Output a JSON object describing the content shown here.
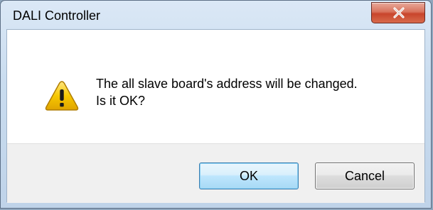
{
  "window": {
    "title": "DALI Controller"
  },
  "message": {
    "line1": "The all slave board's address will be changed.",
    "line2": "Is it OK?",
    "icon": "warning-icon"
  },
  "buttons": {
    "ok_label": "OK",
    "cancel_label": "Cancel"
  },
  "colors": {
    "titlebar": "#c9dcef",
    "close_button": "#c8452c",
    "default_button_border": "#3c7fb1",
    "warning_yellow": "#f5c400"
  }
}
